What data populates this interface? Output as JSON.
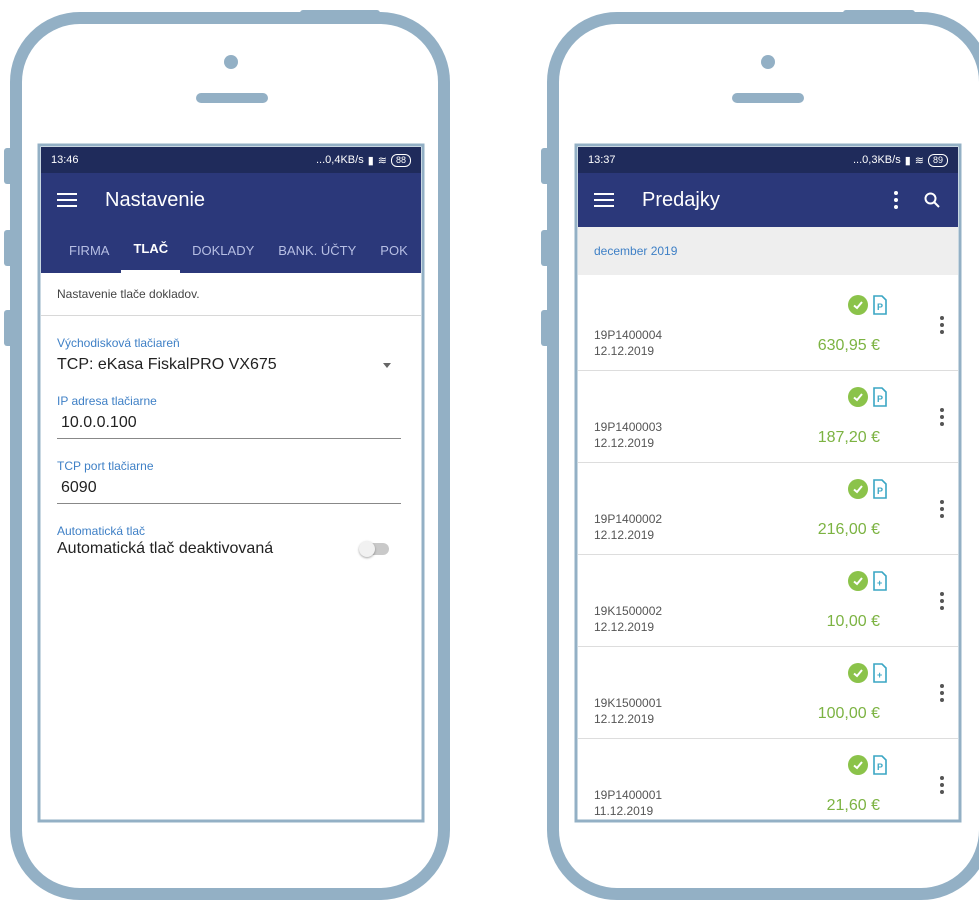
{
  "colors": {
    "frame": "#93b0c5",
    "status_bar": "#1f2b5b",
    "app_bar": "#2b387a",
    "accent_label": "#3f80c6",
    "amount_green": "#7cb342",
    "check_green": "#8bc34a"
  },
  "left": {
    "status": {
      "time": "13:46",
      "indicators": "...0,4KB/s",
      "battery": "88"
    },
    "title": "Nastavenie",
    "tabs": [
      {
        "label": "FIRMA"
      },
      {
        "label": "TLAČ"
      },
      {
        "label": "DOKLADY"
      },
      {
        "label": "BANK. ÚČTY"
      },
      {
        "label": "POK"
      }
    ],
    "description": "Nastavenie tlače dokladov.",
    "printer": {
      "label": "Východisková tlačiareň",
      "value": "TCP: eKasa FiskalPRO VX675"
    },
    "ip": {
      "label": "IP adresa tlačiarne",
      "value": "10.0.0.100"
    },
    "port": {
      "label": "TCP port tlačiarne",
      "value": "6090"
    },
    "auto_print": {
      "label": "Automatická tlač",
      "value": "Automatická tlač deaktivovaná"
    }
  },
  "right": {
    "status": {
      "time": "13:37",
      "indicators": "...0,3KB/s",
      "battery": "89"
    },
    "title": "Predajky",
    "month": "december 2019",
    "sales": [
      {
        "number": "19P1400004",
        "date": "12.12.2019",
        "amount": "630,95 €",
        "doc_icon": "document-p-icon"
      },
      {
        "number": "19P1400003",
        "date": "12.12.2019",
        "amount": "187,20 €",
        "doc_icon": "document-p-icon"
      },
      {
        "number": "19P1400002",
        "date": "12.12.2019",
        "amount": "216,00 €",
        "doc_icon": "document-p-icon"
      },
      {
        "number": "19K1500002",
        "date": "12.12.2019",
        "amount": "10,00 €",
        "doc_icon": "document-add-icon"
      },
      {
        "number": "19K1500001",
        "date": "12.12.2019",
        "amount": "100,00 €",
        "doc_icon": "document-add-icon"
      },
      {
        "number": "19P1400001",
        "date": "11.12.2019",
        "amount": "21,60 €",
        "doc_icon": "document-p-icon"
      }
    ]
  }
}
